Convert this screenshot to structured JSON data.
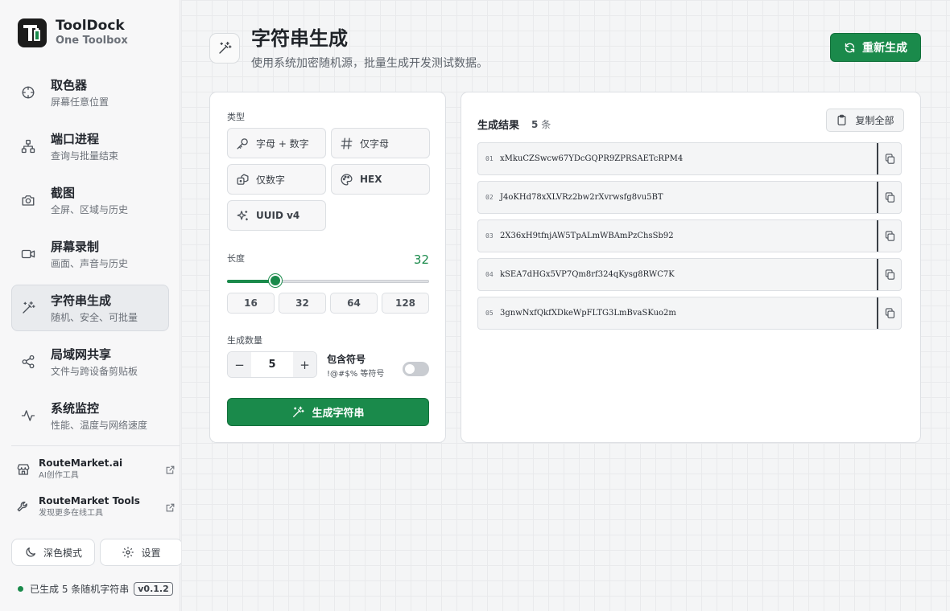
{
  "brand": {
    "title": "ToolDock",
    "subtitle": "One Toolbox"
  },
  "sidebar": {
    "items": [
      {
        "label": "取色器",
        "desc": "屏幕任意位置",
        "icon": "crosshair-icon"
      },
      {
        "label": "端口进程",
        "desc": "查询与批量结束",
        "icon": "network-icon"
      },
      {
        "label": "截图",
        "desc": "全屏、区域与历史",
        "icon": "camera-icon"
      },
      {
        "label": "屏幕录制",
        "desc": "画面、声音与历史",
        "icon": "video-icon"
      },
      {
        "label": "字符串生成",
        "desc": "随机、安全、可批量",
        "icon": "magic-wand-icon",
        "active": true
      },
      {
        "label": "局域网共享",
        "desc": "文件与跨设备剪贴板",
        "icon": "share-icon"
      },
      {
        "label": "系统监控",
        "desc": "性能、温度与网络速度",
        "icon": "activity-icon"
      }
    ],
    "links": [
      {
        "title": "RouteMarket.ai",
        "desc": "AI创作工具",
        "icon": "store-icon"
      },
      {
        "title": "RouteMarket Tools",
        "desc": "发现更多在线工具",
        "icon": "wrench-icon"
      }
    ],
    "dark_mode_label": "深色模式",
    "settings_label": "设置",
    "status_text": "已生成 5 条随机字符串",
    "version": "v0.1.2"
  },
  "header": {
    "title": "字符串生成",
    "subtitle": "使用系统加密随机源，批量生成开发测试数据。",
    "regen_label": "重新生成"
  },
  "options": {
    "type_label": "类型",
    "types": [
      {
        "label": "字母 + 数字",
        "icon": "key-icon"
      },
      {
        "label": "仅字母",
        "icon": "hash-icon"
      },
      {
        "label": "仅数字",
        "icon": "dice-icon"
      },
      {
        "label": "HEX",
        "icon": "palette-icon"
      },
      {
        "label": "UUID v4",
        "icon": "sparkles-icon"
      }
    ],
    "length_label": "长度",
    "length_value": "32",
    "length_presets": [
      "16",
      "32",
      "64",
      "128"
    ],
    "count_label": "生成数量",
    "count_value": "5",
    "symbols_title": "包含符号",
    "symbols_desc": "!@#$% 等符号",
    "symbols_enabled": false,
    "generate_label": "生成字符串"
  },
  "results": {
    "title": "生成结果",
    "count_num": "5",
    "count_unit": "条",
    "copy_all_label": "复制全部",
    "rows": [
      {
        "idx": "01",
        "value": "xMkuCZSwcw67YDcGQPR9ZPRSAETcRPM4"
      },
      {
        "idx": "02",
        "value": "J4oKHd78xXLVRz2bw2rXvrwsfg8vu5BT"
      },
      {
        "idx": "03",
        "value": "2X36xH9tfnjAW5TpALmWBAmPzChsSb92"
      },
      {
        "idx": "04",
        "value": "kSEA7dHGx5VP7Qm8rf324qKysg8RWC7K"
      },
      {
        "idx": "05",
        "value": "3gnwNxfQkfXDkeWpFLTG3LmBvaSKuo2m"
      }
    ]
  },
  "colors": {
    "accent": "#1a8a4b",
    "sidebar_bg": "#f7f7f8",
    "card_bg": "#ffffff"
  }
}
